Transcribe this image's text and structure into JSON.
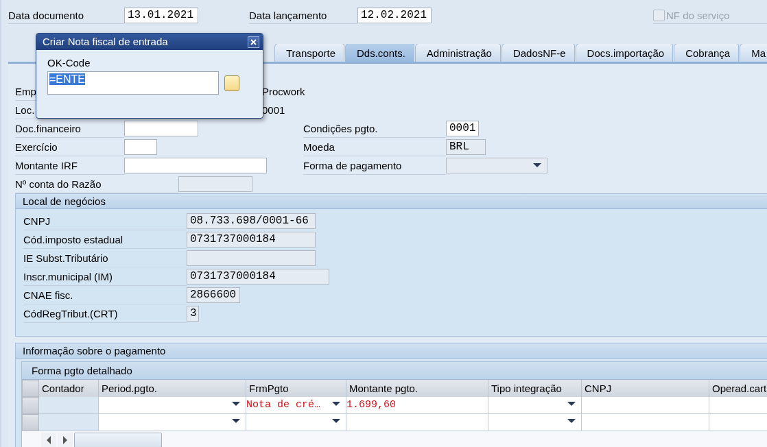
{
  "header_fields": [
    {
      "label": "Data documento",
      "value": "13.01.2021"
    },
    {
      "label": "Data lançamento",
      "value": "12.02.2021"
    }
  ],
  "service_checkbox": {
    "label": "NF do serviço",
    "checked": false,
    "disabled": true
  },
  "tabs": [
    {
      "label": "Transporte",
      "selected": false
    },
    {
      "label": "Dds.conts.",
      "selected": true
    },
    {
      "label": "Administração",
      "selected": false
    },
    {
      "label": "DadosNF-e",
      "selected": false
    },
    {
      "label": "Docs.importação",
      "selected": false
    },
    {
      "label": "Cobrança",
      "selected": false
    },
    {
      "label": "Ma",
      "selected": false
    }
  ],
  "partly_hidden_rows": [
    {
      "label": "Emp",
      "value": "Procwork"
    },
    {
      "label": "Loc.",
      "value": "0001"
    }
  ],
  "left_fields": [
    {
      "label": "Doc.financeiro",
      "disabled": false
    },
    {
      "label": "Exercício",
      "disabled": false
    },
    {
      "label": "Montante IRF",
      "disabled": false
    }
  ],
  "right_fields": [
    {
      "label": "Condições pgto.",
      "value": "0001",
      "disabled": false,
      "kind": "text"
    },
    {
      "label": "Moeda",
      "value": "BRL",
      "disabled": true,
      "kind": "text"
    },
    {
      "label": "Forma de pagamento",
      "disabled": true,
      "kind": "dropdown"
    }
  ],
  "account_field": {
    "label": "Nº conta do Razão",
    "disabled": true
  },
  "business_place": {
    "title": "Local de negócios",
    "fields": [
      {
        "label": "CNPJ",
        "value": "08.733.698/0001-66"
      },
      {
        "label": "Cód.imposto estadual",
        "value": "0731737000184"
      },
      {
        "label": "IE Subst.Tributário"
      },
      {
        "label": "Inscr.municipal (IM)",
        "value": "0731737000184"
      },
      {
        "label": "CNAE fisc.",
        "value": "2866600"
      },
      {
        "label": "CódRegTribut.(CRT)",
        "value": "3"
      }
    ]
  },
  "payment": {
    "title": "Informação sobre o pagamento",
    "table": {
      "title": "Forma pgto detalhado",
      "columns": [
        {
          "label": "Contador",
          "dropdown": false,
          "editable": false
        },
        {
          "label": "Period.pgto.",
          "dropdown": true,
          "editable": true
        },
        {
          "label": "FrmPgto",
          "dropdown": true,
          "editable": true
        },
        {
          "label": "Montante pgto.",
          "dropdown": false,
          "editable": true
        },
        {
          "label": "Tipo integração",
          "dropdown": true,
          "editable": true
        },
        {
          "label": "CNPJ",
          "dropdown": false,
          "editable": true
        },
        {
          "label": "Operad.cart",
          "dropdown": false,
          "editable": true
        }
      ],
      "rows": [
        {
          "kind": "data",
          "highlighted": true,
          "frm_pgto": "Nota de cré…",
          "montante_pgto": "1.699,60"
        },
        {
          "kind": "blank"
        }
      ]
    }
  },
  "dialog": {
    "title": "Criar Nota fiscal de entrada",
    "field_label": "OK-Code",
    "value": "=ENTE",
    "value_selected": true
  }
}
